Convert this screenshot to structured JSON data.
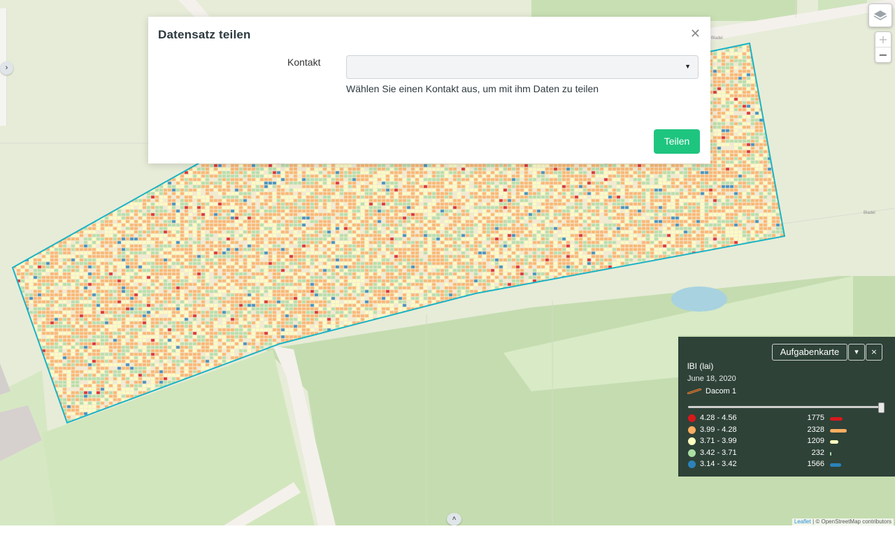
{
  "modal": {
    "title": "Datensatz teilen",
    "close_icon": "close-icon",
    "field_label": "Kontakt",
    "select_value": "",
    "help_text": "Wählen Sie einen Kontakt aus, um mit ihm Daten zu teilen",
    "submit_label": "Teilen",
    "accent_color": "#1ec57f"
  },
  "map": {
    "place_label": "Bladel",
    "attribution_leaflet": "Leaflet",
    "attribution_rest": " | © OpenStreetMap contributors",
    "field_outline_color": "#1ab3c6",
    "controls": {
      "layers_icon": "layers-icon",
      "zoom_in": "+",
      "zoom_out": "−",
      "expand_left_icon": "chevron-right-icon",
      "expand_bottom_icon": "chevron-up-icon"
    }
  },
  "legend": {
    "task_button": "Aufgabenkarte",
    "dropdown_icon": "caret-down-icon",
    "close_icon": "close-icon",
    "title": "lBI (lai)",
    "date": "June 18, 2020",
    "machine": "Dacom 1",
    "slider_level": 1.0,
    "classes": [
      {
        "range": "4.28 - 4.56",
        "count": "1775",
        "color": "#d7191c"
      },
      {
        "range": "3.99 - 4.28",
        "count": "2328",
        "color": "#fdae61"
      },
      {
        "range": "3.71 - 3.99",
        "count": "1209",
        "color": "#ffffbf"
      },
      {
        "range": "3.42 - 3.71",
        "count": "232",
        "color": "#abdda4"
      },
      {
        "range": "3.14 - 3.42",
        "count": "1566",
        "color": "#2b83ba"
      }
    ]
  }
}
